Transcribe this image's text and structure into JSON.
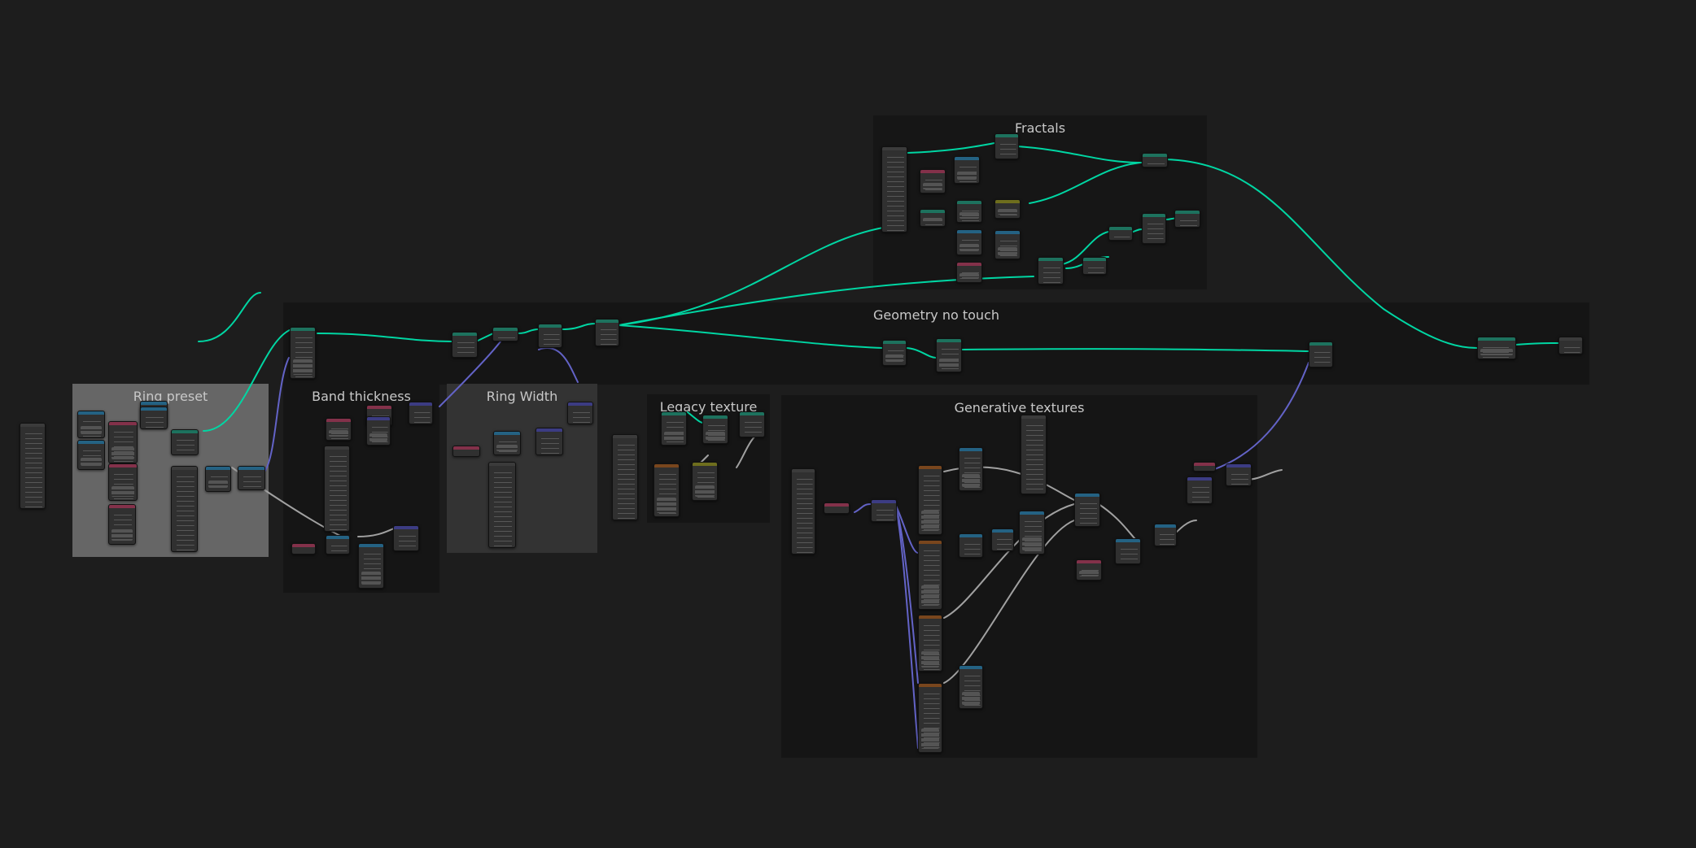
{
  "editor": {
    "name": "geometry-node-editor"
  },
  "colors": {
    "background": "#1d1d1d",
    "geometry_link": "#00d6a3",
    "vector_link": "#6363c7",
    "float_link": "#a1a1a1",
    "geometry_header": "#1d725e",
    "input_header": "#83314a",
    "vector_header": "#3c3c83",
    "texture_header": "#79461d",
    "converter_header": "#246283",
    "color_header": "#6e6e1d"
  },
  "frames": [
    {
      "id": "fractals",
      "label": "Fractals",
      "bg": "#161616"
    },
    {
      "id": "geometry-no-touch",
      "label": "Geometry no touch",
      "bg": "#151515"
    },
    {
      "id": "ring-preset",
      "label": "Ring preset",
      "bg": "#666666"
    },
    {
      "id": "band-thickness",
      "label": "Band thickness",
      "bg": "#151515"
    },
    {
      "id": "ring-width",
      "label": "Ring Width",
      "bg": "#333333"
    },
    {
      "id": "legacy-texture",
      "label": "Legacy texture",
      "bg": "#151515"
    },
    {
      "id": "generative-textures",
      "label": "Generative textures",
      "bg": "#151515"
    }
  ]
}
